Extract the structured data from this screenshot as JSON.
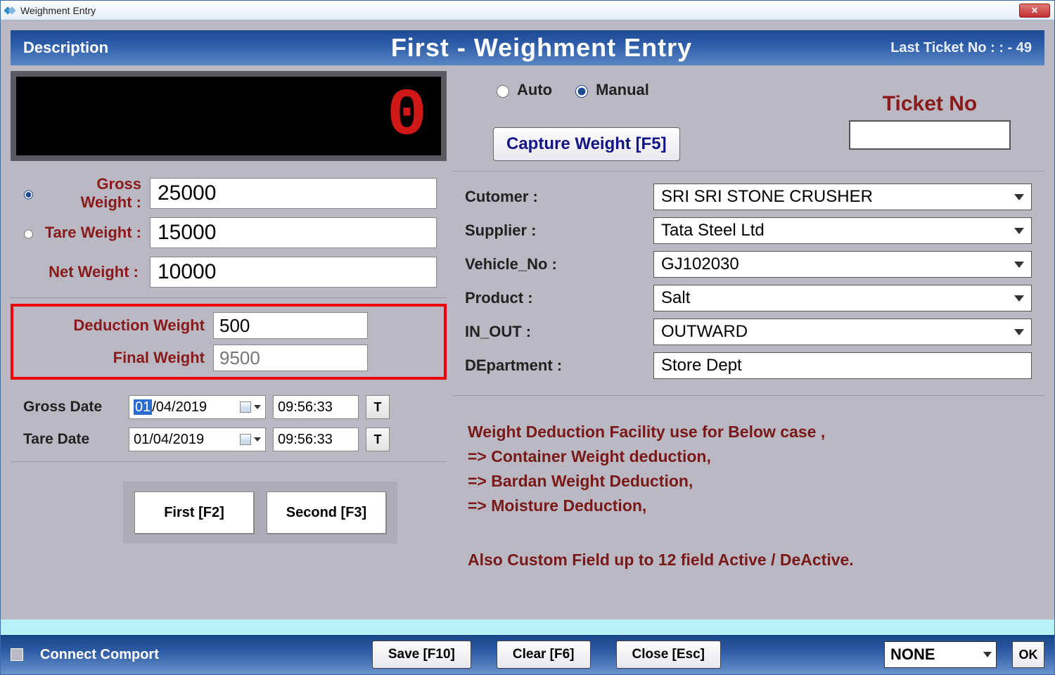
{
  "titlebar": {
    "title": "Weighment Entry"
  },
  "header": {
    "description": "Description",
    "main_title": "First - Weighment Entry",
    "last_ticket": "Last Ticket No :   : - 49"
  },
  "display": {
    "value": "0"
  },
  "weights": {
    "gross_label": "Gross Weight :",
    "gross_value": "25000",
    "tare_label": "Tare Weight  :",
    "tare_value": "15000",
    "net_label": "Net Weight :",
    "net_value": "10000"
  },
  "deduction": {
    "ded_label": "Deduction Weight",
    "ded_value": "500",
    "final_label": "Final Weight",
    "final_value": "9500"
  },
  "dates": {
    "gross_label": "Gross Date",
    "gross_day": "01",
    "gross_rest": "/04/2019",
    "gross_time": "09:56:33",
    "tare_label": "Tare Date",
    "tare_date": "01/04/2019",
    "tare_time": "09:56:33",
    "t_btn": "T"
  },
  "fs": {
    "first": "First [F2]",
    "second": "Second [F3]"
  },
  "mode": {
    "auto": "Auto",
    "manual": "Manual",
    "capture": "Capture Weight [F5]",
    "ticket_label": "Ticket No",
    "ticket_value": ""
  },
  "details": {
    "customer_label": "Cutomer :",
    "customer_value": "SRI SRI STONE CRUSHER",
    "supplier_label": "Supplier :",
    "supplier_value": "Tata Steel Ltd",
    "vehicle_label": "Vehicle_No :",
    "vehicle_value": "GJ102030",
    "product_label": "Product :",
    "product_value": "Salt",
    "inout_label": "IN_OUT :",
    "inout_value": "OUTWARD",
    "dept_label": "DEpartment :",
    "dept_value": "Store Dept"
  },
  "notes": {
    "l1": "Weight Deduction Facility use for Below case ,",
    "l2": "=> Container Weight deduction,",
    "l3": "=> Bardan Weight Deduction,",
    "l4": "=> Moisture Deduction,",
    "l5": "Also Custom Field up to 12 field Active / DeActive."
  },
  "bottom": {
    "connect": "Connect Comport",
    "save": "Save [F10]",
    "clear": "Clear [F6]",
    "close": "Close [Esc]",
    "combo": "NONE",
    "ok": "OK"
  }
}
